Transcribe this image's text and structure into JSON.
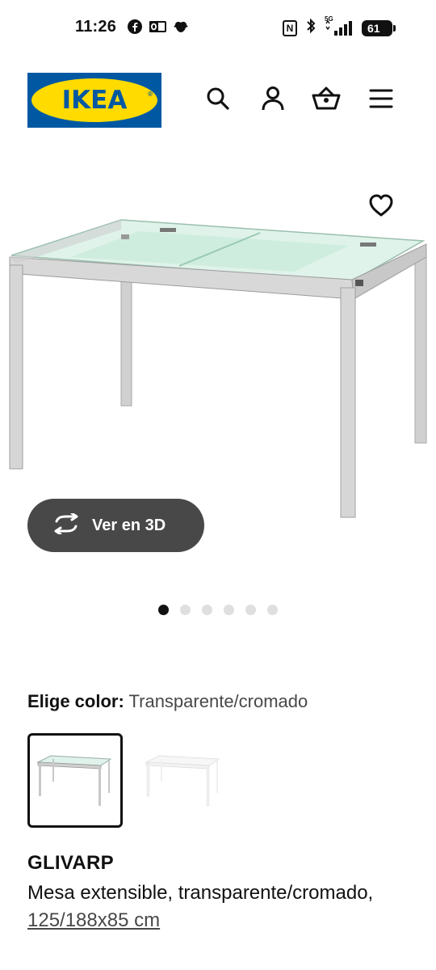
{
  "status_bar": {
    "time": "11:26",
    "network": "5G",
    "battery": "61",
    "left_icons": [
      "facebook-icon",
      "outlook-icon",
      "pet-app-icon"
    ],
    "right_icons": [
      "nfc-icon",
      "bluetooth-icon",
      "signal-icon",
      "battery-icon"
    ]
  },
  "header": {
    "logo_text": "IKEA",
    "logo_colors": {
      "blue": "#0058a3",
      "yellow": "#ffdb00"
    },
    "icons": [
      "search-icon",
      "account-icon",
      "basket-icon",
      "menu-icon"
    ]
  },
  "product_gallery": {
    "image": "glass-extendable-table-image",
    "favorite_icon": "heart-icon",
    "view3d_label": "Ver en 3D",
    "view3d_icon": "rotate-3d-icon",
    "image_count": 6,
    "active_image": 1
  },
  "color_selector": {
    "label": "Elige color:",
    "value": "Transparente/cromado",
    "options": [
      "Transparente/cromado",
      "white-option"
    ]
  },
  "product": {
    "name": "GLIVARP",
    "description": "Mesa extensible, transparente/cromado,",
    "size": "125/188x85 cm"
  },
  "colors": {
    "button_dark": "#484848",
    "text": "#111111",
    "dot_inactive": "#dfdfdf"
  }
}
